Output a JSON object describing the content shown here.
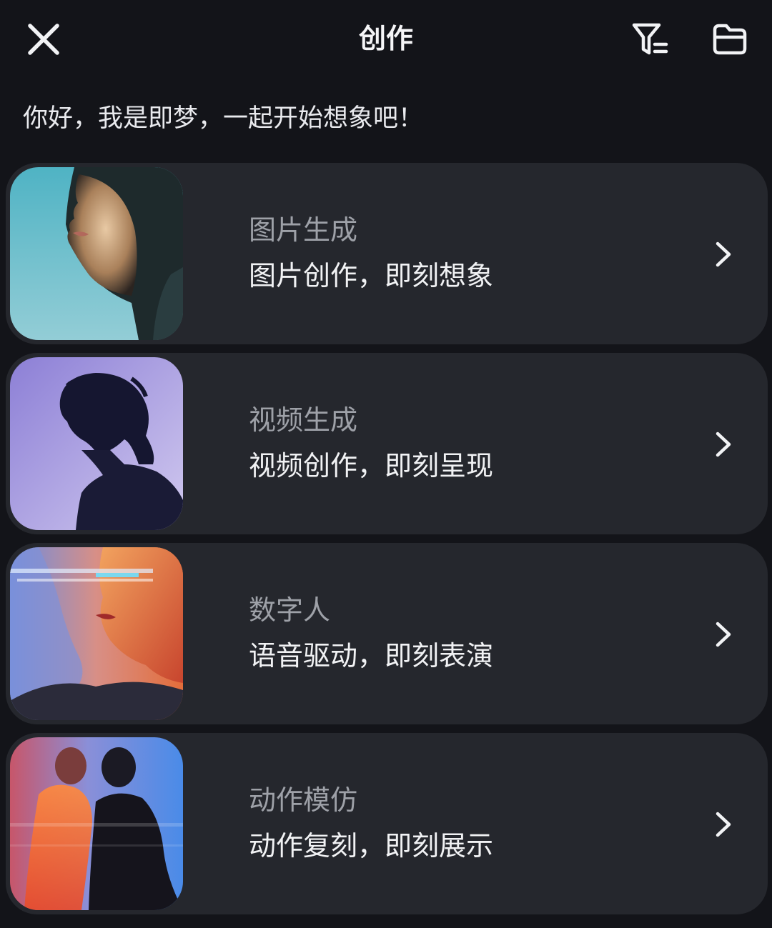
{
  "header": {
    "title": "创作",
    "icons": [
      "close-icon",
      "filter-icon",
      "folder-icon"
    ]
  },
  "greeting": "你好，我是即梦，一起开始想象吧！",
  "features": [
    {
      "title": "图片生成",
      "subtitle": "图片创作，即刻想象",
      "thumbnail": "portrait-profile-teal"
    },
    {
      "title": "视频生成",
      "subtitle": "视频创作，即刻呈现",
      "thumbnail": "silhouette-lavender"
    },
    {
      "title": "数字人",
      "subtitle": "语音驱动，即刻表演",
      "thumbnail": "double-exposure-orange-blue"
    },
    {
      "title": "动作模仿",
      "subtitle": "动作复刻，即刻展示",
      "thumbnail": "motion-blur-silhouettes"
    }
  ],
  "colors": {
    "background": "#131419",
    "card": "#25272d",
    "title_text": "#9ea1a8",
    "subtitle_text": "#f1f2f4"
  }
}
